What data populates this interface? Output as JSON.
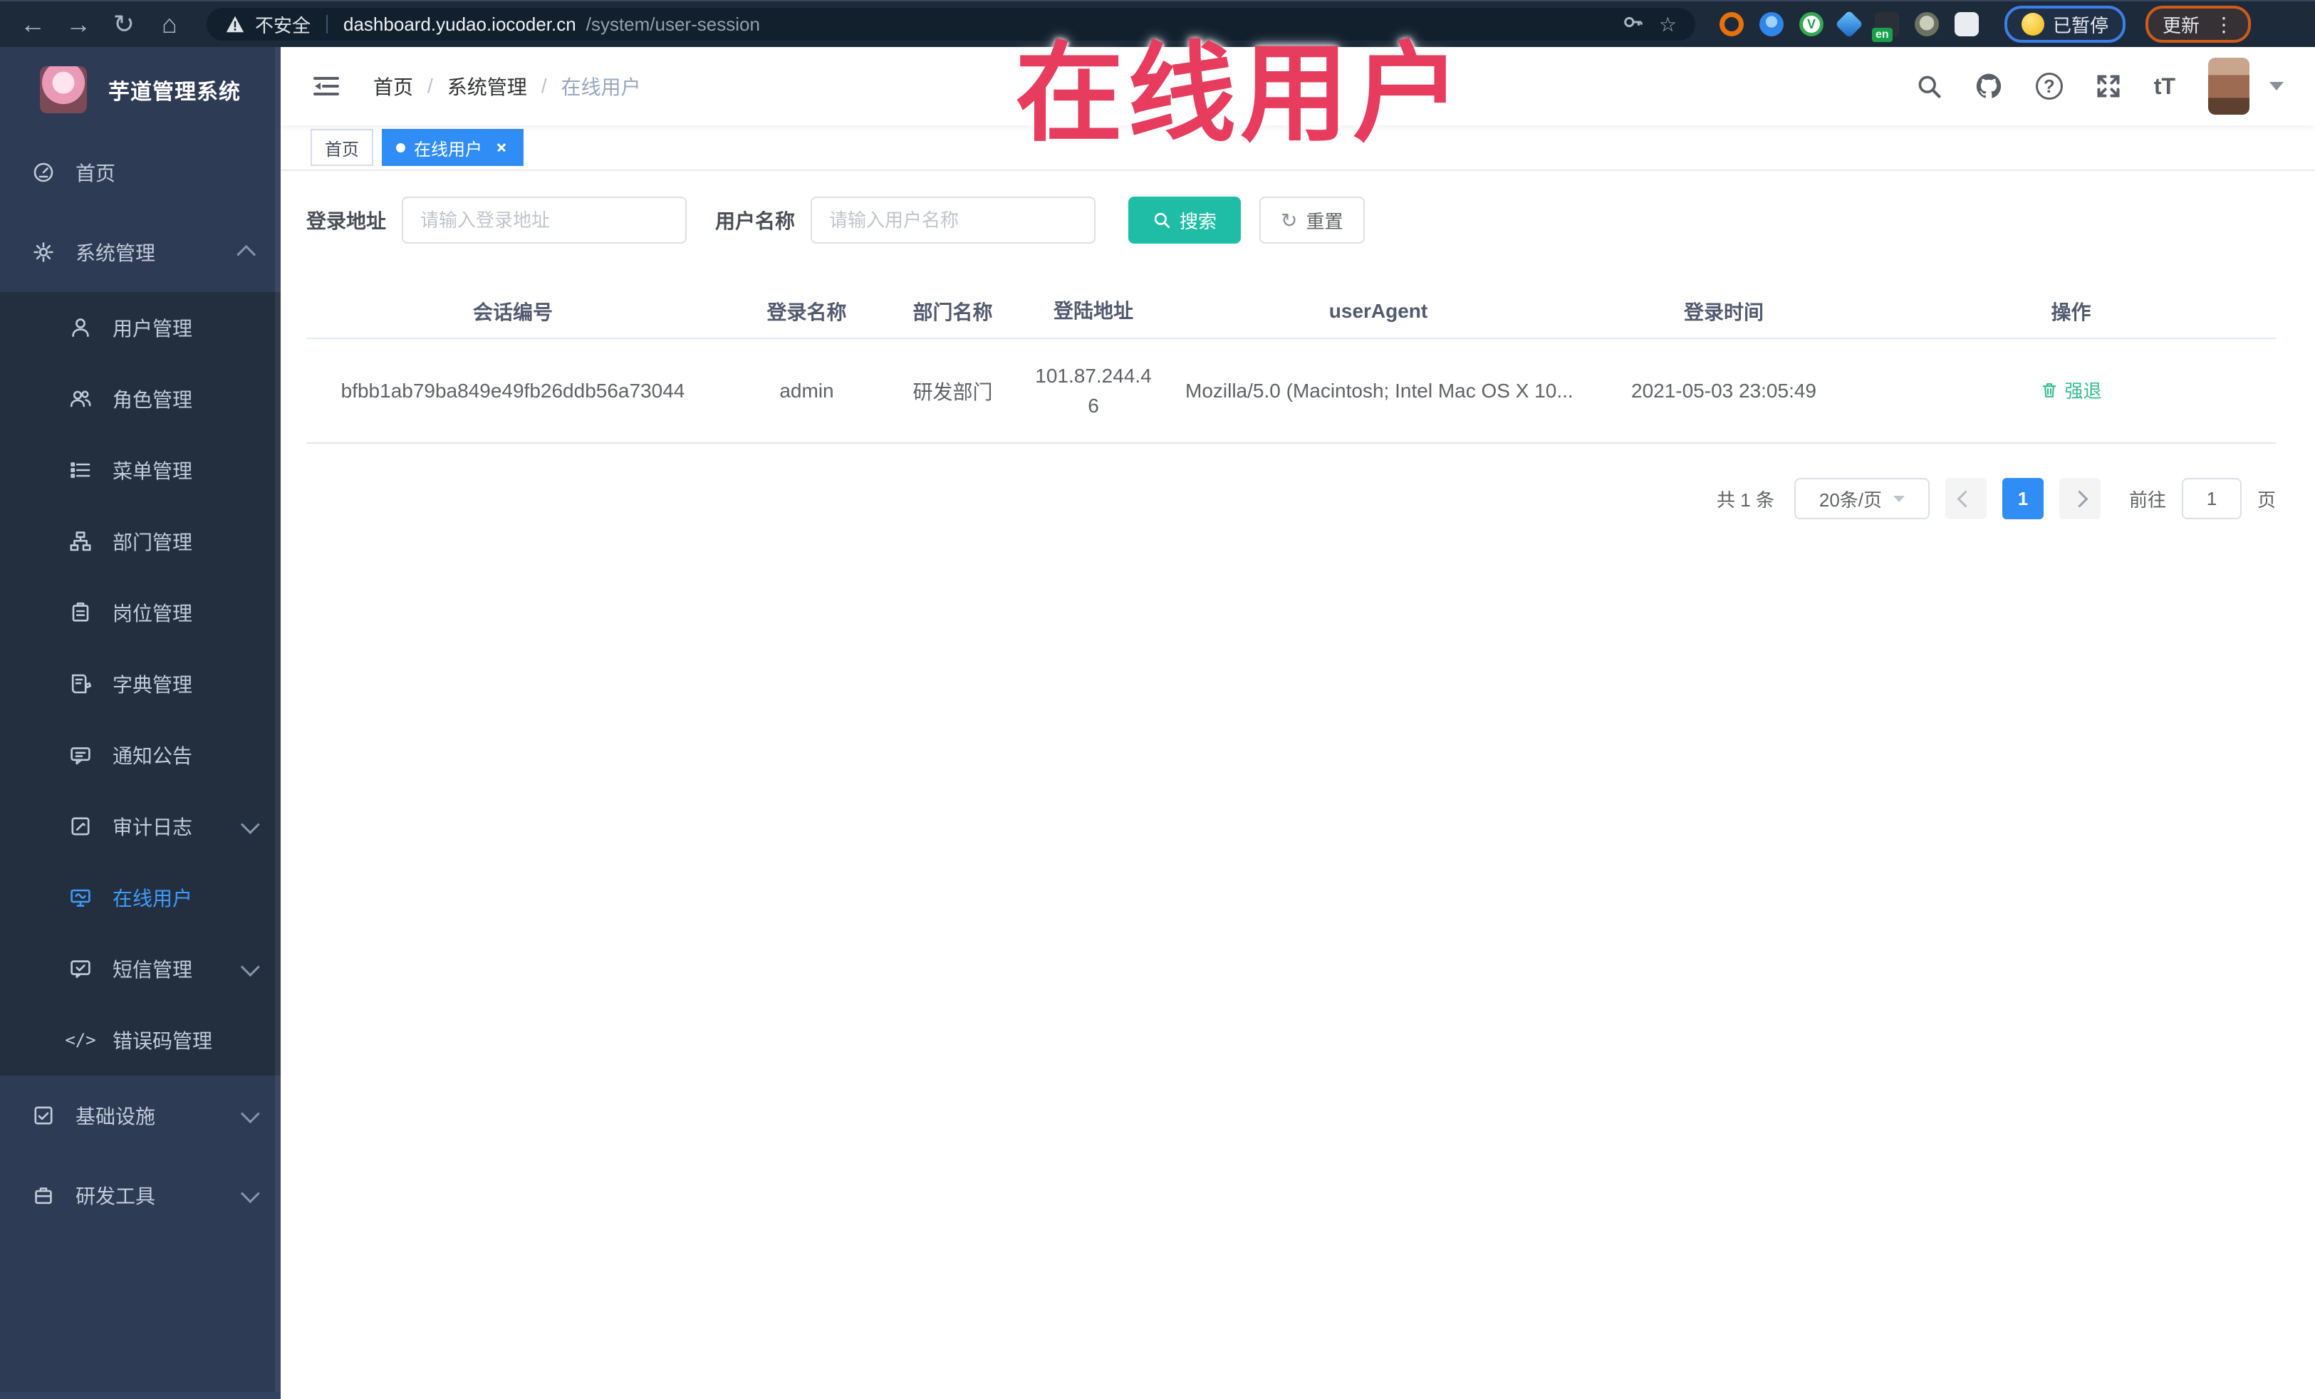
{
  "browser": {
    "security_label": "不安全",
    "url_host": "dashboard.yudao.iocoder.cn",
    "url_path": "/system/user-session",
    "paused_badge": "已暂停",
    "update_button": "更新"
  },
  "watermark": "在线用户",
  "icons": {
    "back": "←",
    "forward": "→",
    "reload": "↻",
    "home": "⌂",
    "star": "☆",
    "help": "?",
    "font_size": "tT",
    "overflow": "⋮",
    "en_badge": "en",
    "extension_v": "V",
    "error_code": "</>"
  },
  "sidebar": {
    "title": "芋道管理系统",
    "items": [
      {
        "label": "首页"
      },
      {
        "label": "系统管理"
      },
      {
        "label": "用户管理"
      },
      {
        "label": "角色管理"
      },
      {
        "label": "菜单管理"
      },
      {
        "label": "部门管理"
      },
      {
        "label": "岗位管理"
      },
      {
        "label": "字典管理"
      },
      {
        "label": "通知公告"
      },
      {
        "label": "审计日志"
      },
      {
        "label": "在线用户"
      },
      {
        "label": "短信管理"
      },
      {
        "label": "错误码管理"
      },
      {
        "label": "基础设施"
      },
      {
        "label": "研发工具"
      }
    ]
  },
  "header": {
    "breadcrumb": [
      "首页",
      "系统管理",
      "在线用户"
    ],
    "breadcrumb_separator": "/"
  },
  "tags": [
    {
      "label": "首页"
    },
    {
      "label": "在线用户"
    }
  ],
  "filters": {
    "address_label": "登录地址",
    "address_placeholder": "请输入登录地址",
    "username_label": "用户名称",
    "username_placeholder": "请输入用户名称",
    "search_label": "搜索",
    "reset_label": "重置"
  },
  "table": {
    "columns": [
      "会话编号",
      "登录名称",
      "部门名称",
      "登陆地址",
      "userAgent",
      "登录时间",
      "操作"
    ],
    "rows": [
      {
        "session_id": "bfbb1ab79ba849e49fb26ddb56a73044",
        "username": "admin",
        "dept": "研发部门",
        "ip": "101.87.244.46",
        "user_agent": "Mozilla/5.0 (Macintosh; Intel Mac OS X 10...",
        "login_time": "2021-05-03 23:05:49",
        "action": "强退"
      }
    ]
  },
  "pagination": {
    "total": "共 1 条",
    "page_size": "20条/页",
    "current_page": "1",
    "goto_label": "前往",
    "goto_value": "1",
    "page_unit": "页"
  },
  "colors": {
    "accent_blue": "#2F8DF5",
    "search_teal": "#1FBDA6",
    "action_green": "#33BD8E",
    "watermark_red": "#E73C5E",
    "sidebar_bg": "#2D3B55",
    "submenu_bg": "#232F3F"
  }
}
